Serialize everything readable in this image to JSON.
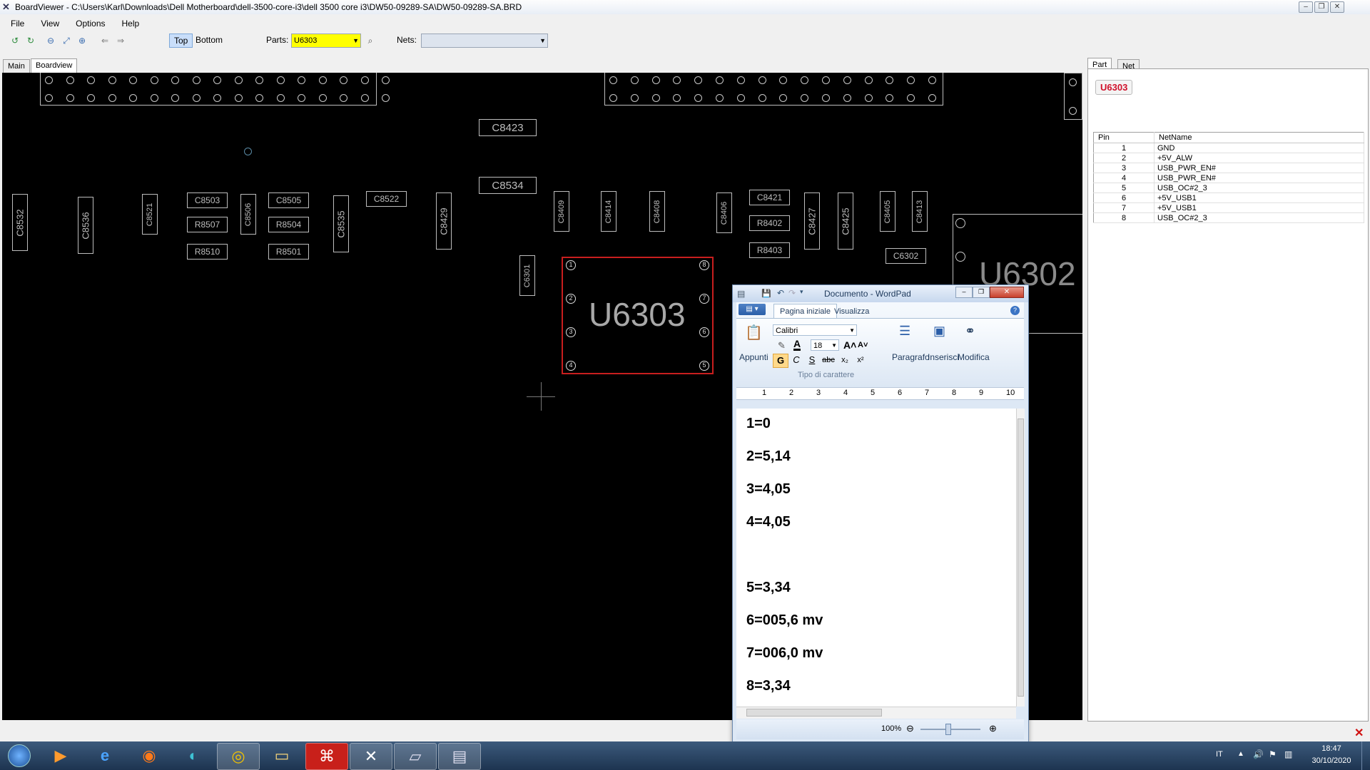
{
  "window": {
    "title": "BoardViewer  -  C:\\Users\\Karl\\Downloads\\Dell Motherboard\\dell-3500-core-i3\\dell 3500 core i3\\DW50-09289-SA\\DW50-09289-SA.BRD"
  },
  "menu": [
    "File",
    "View",
    "Options",
    "Help"
  ],
  "toolbar": {
    "top_label": "Top",
    "bottom_label": "Bottom",
    "parts_label": "Parts:",
    "parts_value": "U6303",
    "nets_label": "Nets:",
    "nets_value": ""
  },
  "tabs": {
    "main": "Main",
    "boardview": "Boardview"
  },
  "board": {
    "selected_part": "U6303",
    "parts": [
      "C8423",
      "C8534",
      "C8532",
      "C8536",
      "C8521",
      "C8503",
      "R8507",
      "R8510",
      "C8506",
      "C8505",
      "R8504",
      "R8501",
      "C8535",
      "C8522",
      "C8429",
      "C8409",
      "C8414",
      "C8408",
      "C8406",
      "C8421",
      "R8402",
      "R8403",
      "C8427",
      "C8425",
      "C8405",
      "C8413",
      "C6302",
      "C6301",
      "U6302"
    ],
    "pin_numbers": [
      "1",
      "2",
      "3",
      "4",
      "5",
      "6",
      "7",
      "8"
    ]
  },
  "right_panel": {
    "tabs": [
      "Part",
      "Net"
    ],
    "part_badge": "U6303",
    "columns": [
      "Pin",
      "NetName"
    ],
    "pins": [
      {
        "pin": "1",
        "net": "GND"
      },
      {
        "pin": "2",
        "net": "+5V_ALW"
      },
      {
        "pin": "3",
        "net": "USB_PWR_EN#"
      },
      {
        "pin": "4",
        "net": "USB_PWR_EN#"
      },
      {
        "pin": "5",
        "net": "USB_OC#2_3"
      },
      {
        "pin": "6",
        "net": "+5V_USB1"
      },
      {
        "pin": "7",
        "net": "+5V_USB1"
      },
      {
        "pin": "8",
        "net": "USB_OC#2_3"
      }
    ]
  },
  "wordpad": {
    "title": "Documento - WordPad",
    "tabs": [
      "Pagina iniziale",
      "Visualizza"
    ],
    "font": "Calibri",
    "font_size": "18",
    "groups": {
      "clipboard": "Appunti",
      "font": "Tipo di carattere",
      "paragraph": "Paragrafo",
      "insert": "Inserisci",
      "edit": "Modifica"
    },
    "format_buttons": [
      "G",
      "C",
      "S",
      "abc",
      "x₂",
      "x²"
    ],
    "ruler": [
      "1",
      "2",
      "3",
      "4",
      "5",
      "6",
      "7",
      "8",
      "9",
      "10"
    ],
    "lines": [
      "1=0",
      "2=5,14",
      "3=4,05",
      "4=4,05",
      "",
      "5=3,34",
      "6=005,6 mv",
      "7=006,0 mv",
      "8=3,34"
    ],
    "zoom": "100%"
  },
  "taskbar": {
    "language": "IT",
    "time": "18:47",
    "date": "30/10/2020"
  }
}
